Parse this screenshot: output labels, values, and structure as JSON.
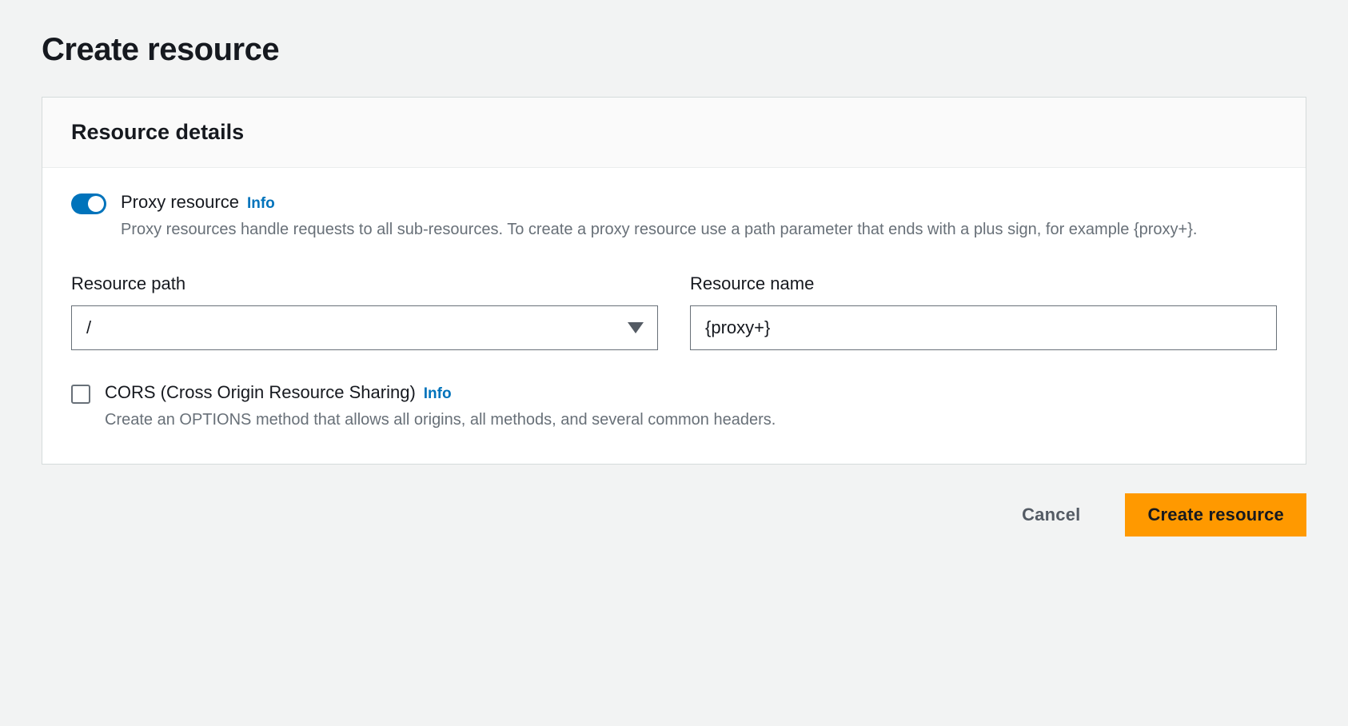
{
  "page": {
    "title": "Create resource"
  },
  "panel": {
    "header": "Resource details",
    "proxy": {
      "enabled": true,
      "label": "Proxy resource",
      "info": "Info",
      "description": "Proxy resources handle requests to all sub-resources. To create a proxy resource use a path parameter that ends with a plus sign, for example {proxy+}."
    },
    "fields": {
      "path": {
        "label": "Resource path",
        "value": "/"
      },
      "name": {
        "label": "Resource name",
        "value": "{proxy+}"
      }
    },
    "cors": {
      "checked": false,
      "label": "CORS (Cross Origin Resource Sharing)",
      "info": "Info",
      "description": "Create an OPTIONS method that allows all origins, all methods, and several common headers."
    }
  },
  "footer": {
    "cancel": "Cancel",
    "submit": "Create resource"
  }
}
